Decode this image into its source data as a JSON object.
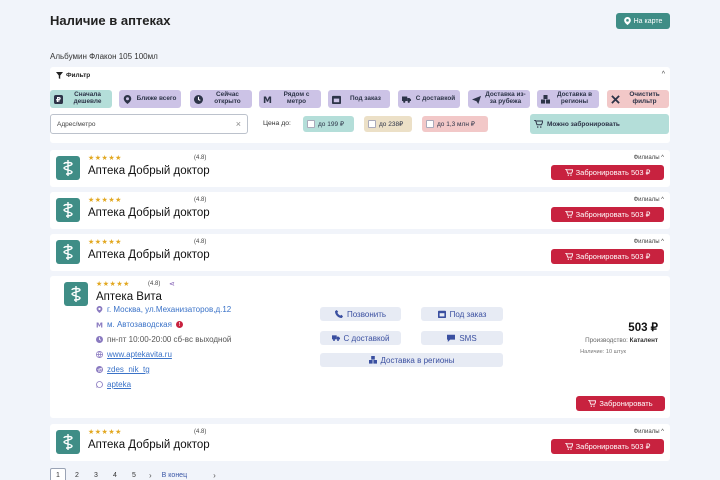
{
  "header": {
    "title": "Наличие в аптеках",
    "map_button": "На карте",
    "product": "Альбумин Флакон 105 100мл"
  },
  "filter": {
    "title": "Фильтр",
    "chips": [
      "Сначала дешевле",
      "Ближе всего",
      "Сейчас открыто",
      "Рядом с метро",
      "Под заказ",
      "С доставкой",
      "Доставка из-за рубежа",
      "Доставка в регионы",
      "Очистить фильтр"
    ],
    "address_placeholder": "Адрес/метро",
    "price_label": "Цена до:",
    "price_options": [
      "до 199 ₽",
      "до 238₽",
      "до 1,3 млн ₽"
    ],
    "reserve_toggle": "Можно забронировать"
  },
  "cards": [
    {
      "name": "Аптека Добрый доктор",
      "rating": "(4.8)",
      "branches": "Филиалы ^",
      "book": "Забронировать 503 ₽"
    },
    {
      "name": "Аптека Добрый доктор",
      "rating": "(4.8)",
      "branches": "Филиалы ^",
      "book": "Забронировать 503 ₽"
    },
    {
      "name": "Аптека Добрый доктор",
      "rating": "(4.8)",
      "branches": "Филиалы ^",
      "book": "Забронировать 503 ₽"
    },
    {
      "name": "Аптека Добрый доктор",
      "rating": "(4.8)",
      "branches": "Филиалы ^",
      "book": "Забронировать 503 ₽"
    }
  ],
  "detail": {
    "name": "Аптека Вита",
    "rating": "(4.8)",
    "address": "г. Москва, ул.Механизаторов,д.12",
    "metro": "м. Автозаводская",
    "hours": "пн-пт 10:00-20:00 сб-вс выходной",
    "site": "www.aptekavita.ru",
    "telegram": "zdes_nik_tg",
    "whatsapp": "apteka",
    "actions": [
      "Позвонить",
      "Под заказ",
      "С доставкой",
      "SMS",
      "Доставка в регионы"
    ],
    "price": "503 ₽",
    "maker_label": "Производство:",
    "maker": "Каталент",
    "stock": "Наличие: 10 штук",
    "book": "Забронировать"
  },
  "pager": {
    "pages": [
      "1",
      "2",
      "3",
      "4",
      "5"
    ],
    "end": "В конец"
  },
  "colors": {
    "accent": "#3f8d86",
    "book": "#c8223f",
    "stars": "#e2a822"
  }
}
